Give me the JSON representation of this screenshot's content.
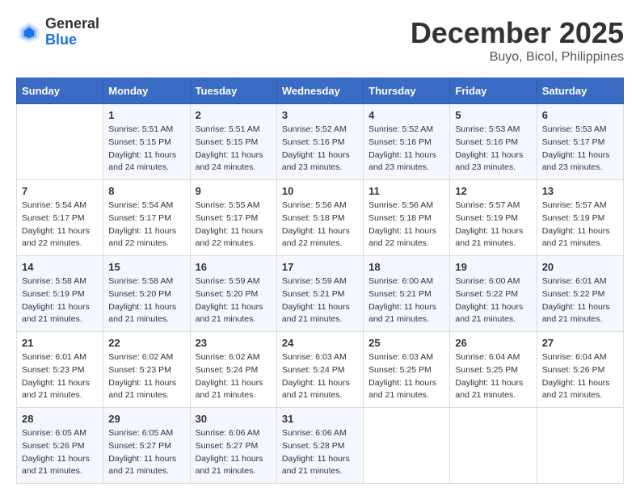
{
  "header": {
    "logo_general": "General",
    "logo_blue": "Blue",
    "month": "December 2025",
    "location": "Buyo, Bicol, Philippines"
  },
  "weekdays": [
    "Sunday",
    "Monday",
    "Tuesday",
    "Wednesday",
    "Thursday",
    "Friday",
    "Saturday"
  ],
  "weeks": [
    [
      {
        "day": "",
        "sunrise": "",
        "sunset": "",
        "daylight": ""
      },
      {
        "day": "1",
        "sunrise": "Sunrise: 5:51 AM",
        "sunset": "Sunset: 5:15 PM",
        "daylight": "Daylight: 11 hours and 24 minutes."
      },
      {
        "day": "2",
        "sunrise": "Sunrise: 5:51 AM",
        "sunset": "Sunset: 5:15 PM",
        "daylight": "Daylight: 11 hours and 24 minutes."
      },
      {
        "day": "3",
        "sunrise": "Sunrise: 5:52 AM",
        "sunset": "Sunset: 5:16 PM",
        "daylight": "Daylight: 11 hours and 23 minutes."
      },
      {
        "day": "4",
        "sunrise": "Sunrise: 5:52 AM",
        "sunset": "Sunset: 5:16 PM",
        "daylight": "Daylight: 11 hours and 23 minutes."
      },
      {
        "day": "5",
        "sunrise": "Sunrise: 5:53 AM",
        "sunset": "Sunset: 5:16 PM",
        "daylight": "Daylight: 11 hours and 23 minutes."
      },
      {
        "day": "6",
        "sunrise": "Sunrise: 5:53 AM",
        "sunset": "Sunset: 5:17 PM",
        "daylight": "Daylight: 11 hours and 23 minutes."
      }
    ],
    [
      {
        "day": "7",
        "sunrise": "Sunrise: 5:54 AM",
        "sunset": "Sunset: 5:17 PM",
        "daylight": "Daylight: 11 hours and 22 minutes."
      },
      {
        "day": "8",
        "sunrise": "Sunrise: 5:54 AM",
        "sunset": "Sunset: 5:17 PM",
        "daylight": "Daylight: 11 hours and 22 minutes."
      },
      {
        "day": "9",
        "sunrise": "Sunrise: 5:55 AM",
        "sunset": "Sunset: 5:17 PM",
        "daylight": "Daylight: 11 hours and 22 minutes."
      },
      {
        "day": "10",
        "sunrise": "Sunrise: 5:56 AM",
        "sunset": "Sunset: 5:18 PM",
        "daylight": "Daylight: 11 hours and 22 minutes."
      },
      {
        "day": "11",
        "sunrise": "Sunrise: 5:56 AM",
        "sunset": "Sunset: 5:18 PM",
        "daylight": "Daylight: 11 hours and 22 minutes."
      },
      {
        "day": "12",
        "sunrise": "Sunrise: 5:57 AM",
        "sunset": "Sunset: 5:19 PM",
        "daylight": "Daylight: 11 hours and 21 minutes."
      },
      {
        "day": "13",
        "sunrise": "Sunrise: 5:57 AM",
        "sunset": "Sunset: 5:19 PM",
        "daylight": "Daylight: 11 hours and 21 minutes."
      }
    ],
    [
      {
        "day": "14",
        "sunrise": "Sunrise: 5:58 AM",
        "sunset": "Sunset: 5:19 PM",
        "daylight": "Daylight: 11 hours and 21 minutes."
      },
      {
        "day": "15",
        "sunrise": "Sunrise: 5:58 AM",
        "sunset": "Sunset: 5:20 PM",
        "daylight": "Daylight: 11 hours and 21 minutes."
      },
      {
        "day": "16",
        "sunrise": "Sunrise: 5:59 AM",
        "sunset": "Sunset: 5:20 PM",
        "daylight": "Daylight: 11 hours and 21 minutes."
      },
      {
        "day": "17",
        "sunrise": "Sunrise: 5:59 AM",
        "sunset": "Sunset: 5:21 PM",
        "daylight": "Daylight: 11 hours and 21 minutes."
      },
      {
        "day": "18",
        "sunrise": "Sunrise: 6:00 AM",
        "sunset": "Sunset: 5:21 PM",
        "daylight": "Daylight: 11 hours and 21 minutes."
      },
      {
        "day": "19",
        "sunrise": "Sunrise: 6:00 AM",
        "sunset": "Sunset: 5:22 PM",
        "daylight": "Daylight: 11 hours and 21 minutes."
      },
      {
        "day": "20",
        "sunrise": "Sunrise: 6:01 AM",
        "sunset": "Sunset: 5:22 PM",
        "daylight": "Daylight: 11 hours and 21 minutes."
      }
    ],
    [
      {
        "day": "21",
        "sunrise": "Sunrise: 6:01 AM",
        "sunset": "Sunset: 5:23 PM",
        "daylight": "Daylight: 11 hours and 21 minutes."
      },
      {
        "day": "22",
        "sunrise": "Sunrise: 6:02 AM",
        "sunset": "Sunset: 5:23 PM",
        "daylight": "Daylight: 11 hours and 21 minutes."
      },
      {
        "day": "23",
        "sunrise": "Sunrise: 6:02 AM",
        "sunset": "Sunset: 5:24 PM",
        "daylight": "Daylight: 11 hours and 21 minutes."
      },
      {
        "day": "24",
        "sunrise": "Sunrise: 6:03 AM",
        "sunset": "Sunset: 5:24 PM",
        "daylight": "Daylight: 11 hours and 21 minutes."
      },
      {
        "day": "25",
        "sunrise": "Sunrise: 6:03 AM",
        "sunset": "Sunset: 5:25 PM",
        "daylight": "Daylight: 11 hours and 21 minutes."
      },
      {
        "day": "26",
        "sunrise": "Sunrise: 6:04 AM",
        "sunset": "Sunset: 5:25 PM",
        "daylight": "Daylight: 11 hours and 21 minutes."
      },
      {
        "day": "27",
        "sunrise": "Sunrise: 6:04 AM",
        "sunset": "Sunset: 5:26 PM",
        "daylight": "Daylight: 11 hours and 21 minutes."
      }
    ],
    [
      {
        "day": "28",
        "sunrise": "Sunrise: 6:05 AM",
        "sunset": "Sunset: 5:26 PM",
        "daylight": "Daylight: 11 hours and 21 minutes."
      },
      {
        "day": "29",
        "sunrise": "Sunrise: 6:05 AM",
        "sunset": "Sunset: 5:27 PM",
        "daylight": "Daylight: 11 hours and 21 minutes."
      },
      {
        "day": "30",
        "sunrise": "Sunrise: 6:06 AM",
        "sunset": "Sunset: 5:27 PM",
        "daylight": "Daylight: 11 hours and 21 minutes."
      },
      {
        "day": "31",
        "sunrise": "Sunrise: 6:06 AM",
        "sunset": "Sunset: 5:28 PM",
        "daylight": "Daylight: 11 hours and 21 minutes."
      },
      {
        "day": "",
        "sunrise": "",
        "sunset": "",
        "daylight": ""
      },
      {
        "day": "",
        "sunrise": "",
        "sunset": "",
        "daylight": ""
      },
      {
        "day": "",
        "sunrise": "",
        "sunset": "",
        "daylight": ""
      }
    ]
  ]
}
